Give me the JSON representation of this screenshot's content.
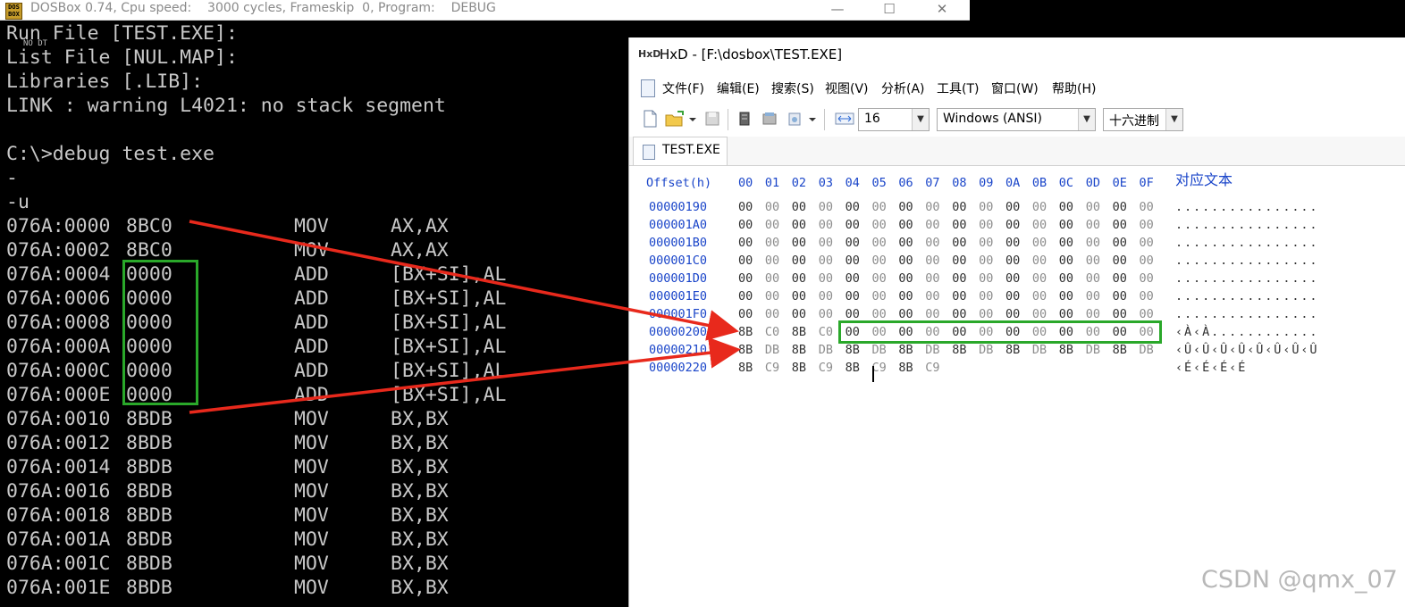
{
  "dosbox": {
    "title": "DOSBox 0.74, Cpu speed:    3000 cycles, Frameskip  0, Program:    DEBUG",
    "icon": "dosbox-icon",
    "window_buttons": [
      "—",
      "☐",
      "✕"
    ],
    "pre_lines": [
      "Run File [TEST.EXE]:",
      "List File [NUL.MAP]:",
      "Libraries [.LIB]:",
      "LINK : warning L4021: no stack segment",
      "",
      "C:\\>debug test.exe",
      "-",
      "-u"
    ],
    "overlay_text": "NO DT",
    "disasm": [
      {
        "addr": "076A:0000",
        "bytes": "8BC0",
        "mnemonic": "MOV",
        "operands": "AX,AX"
      },
      {
        "addr": "076A:0002",
        "bytes": "8BC0",
        "mnemonic": "MOV",
        "operands": "AX,AX"
      },
      {
        "addr": "076A:0004",
        "bytes": "0000",
        "mnemonic": "ADD",
        "operands": "[BX+SI],AL"
      },
      {
        "addr": "076A:0006",
        "bytes": "0000",
        "mnemonic": "ADD",
        "operands": "[BX+SI],AL"
      },
      {
        "addr": "076A:0008",
        "bytes": "0000",
        "mnemonic": "ADD",
        "operands": "[BX+SI],AL"
      },
      {
        "addr": "076A:000A",
        "bytes": "0000",
        "mnemonic": "ADD",
        "operands": "[BX+SI],AL"
      },
      {
        "addr": "076A:000C",
        "bytes": "0000",
        "mnemonic": "ADD",
        "operands": "[BX+SI],AL"
      },
      {
        "addr": "076A:000E",
        "bytes": "0000",
        "mnemonic": "ADD",
        "operands": "[BX+SI],AL"
      },
      {
        "addr": "076A:0010",
        "bytes": "8BDB",
        "mnemonic": "MOV",
        "operands": "BX,BX"
      },
      {
        "addr": "076A:0012",
        "bytes": "8BDB",
        "mnemonic": "MOV",
        "operands": "BX,BX"
      },
      {
        "addr": "076A:0014",
        "bytes": "8BDB",
        "mnemonic": "MOV",
        "operands": "BX,BX"
      },
      {
        "addr": "076A:0016",
        "bytes": "8BDB",
        "mnemonic": "MOV",
        "operands": "BX,BX"
      },
      {
        "addr": "076A:0018",
        "bytes": "8BDB",
        "mnemonic": "MOV",
        "operands": "BX,BX"
      },
      {
        "addr": "076A:001A",
        "bytes": "8BDB",
        "mnemonic": "MOV",
        "operands": "BX,BX"
      },
      {
        "addr": "076A:001C",
        "bytes": "8BDB",
        "mnemonic": "MOV",
        "operands": "BX,BX"
      },
      {
        "addr": "076A:001E",
        "bytes": "8BDB",
        "mnemonic": "MOV",
        "operands": "BX,BX"
      }
    ]
  },
  "hxd": {
    "title": "HxD - [F:\\dosbox\\TEST.EXE]",
    "menu": [
      "文件(F)",
      "编辑(E)",
      "搜索(S)",
      "视图(V)",
      "分析(A)",
      "工具(T)",
      "窗口(W)",
      "帮助(H)"
    ],
    "toolbar": {
      "bytes_per_row": "16",
      "charset": "Windows (ANSI)",
      "offset_base": "十六进制",
      "icons": [
        "new-file-icon",
        "open-folder-icon",
        "save-icon",
        "ram-icon",
        "disk-icon",
        "open-disk-icon",
        "bytes-per-row-icon"
      ]
    },
    "tab": "TEST.EXE",
    "header": {
      "offset_label": "Offset(h)",
      "columns": [
        "00",
        "01",
        "02",
        "03",
        "04",
        "05",
        "06",
        "07",
        "08",
        "09",
        "0A",
        "0B",
        "0C",
        "0D",
        "0E",
        "0F"
      ],
      "text_label": "对应文本"
    },
    "rows": [
      {
        "offset": "00000190",
        "bytes": [
          "00",
          "00",
          "00",
          "00",
          "00",
          "00",
          "00",
          "00",
          "00",
          "00",
          "00",
          "00",
          "00",
          "00",
          "00",
          "00"
        ],
        "text": "................"
      },
      {
        "offset": "000001A0",
        "bytes": [
          "00",
          "00",
          "00",
          "00",
          "00",
          "00",
          "00",
          "00",
          "00",
          "00",
          "00",
          "00",
          "00",
          "00",
          "00",
          "00"
        ],
        "text": "................"
      },
      {
        "offset": "000001B0",
        "bytes": [
          "00",
          "00",
          "00",
          "00",
          "00",
          "00",
          "00",
          "00",
          "00",
          "00",
          "00",
          "00",
          "00",
          "00",
          "00",
          "00"
        ],
        "text": "................"
      },
      {
        "offset": "000001C0",
        "bytes": [
          "00",
          "00",
          "00",
          "00",
          "00",
          "00",
          "00",
          "00",
          "00",
          "00",
          "00",
          "00",
          "00",
          "00",
          "00",
          "00"
        ],
        "text": "................"
      },
      {
        "offset": "000001D0",
        "bytes": [
          "00",
          "00",
          "00",
          "00",
          "00",
          "00",
          "00",
          "00",
          "00",
          "00",
          "00",
          "00",
          "00",
          "00",
          "00",
          "00"
        ],
        "text": "................"
      },
      {
        "offset": "000001E0",
        "bytes": [
          "00",
          "00",
          "00",
          "00",
          "00",
          "00",
          "00",
          "00",
          "00",
          "00",
          "00",
          "00",
          "00",
          "00",
          "00",
          "00"
        ],
        "text": "................"
      },
      {
        "offset": "000001F0",
        "bytes": [
          "00",
          "00",
          "00",
          "00",
          "00",
          "00",
          "00",
          "00",
          "00",
          "00",
          "00",
          "00",
          "00",
          "00",
          "00",
          "00"
        ],
        "text": "................"
      },
      {
        "offset": "00000200",
        "bytes": [
          "8B",
          "C0",
          "8B",
          "C0",
          "00",
          "00",
          "00",
          "00",
          "00",
          "00",
          "00",
          "00",
          "00",
          "00",
          "00",
          "00"
        ],
        "text": "‹À‹À............"
      },
      {
        "offset": "00000210",
        "bytes": [
          "8B",
          "DB",
          "8B",
          "DB",
          "8B",
          "DB",
          "8B",
          "DB",
          "8B",
          "DB",
          "8B",
          "DB",
          "8B",
          "DB",
          "8B",
          "DB"
        ],
        "text": "‹Û‹Û‹Û‹Û‹Û‹Û‹Û‹Û"
      },
      {
        "offset": "00000220",
        "bytes": [
          "8B",
          "C9",
          "8B",
          "C9",
          "8B",
          "C9",
          "8B",
          "C9"
        ],
        "text": "‹É‹É‹É‹É"
      }
    ]
  },
  "watermark": "CSDN @qmx_07",
  "colors": {
    "highlight_box": "#2aa82a",
    "arrow": "#e8291c",
    "offset_blue": "#1a45c9"
  }
}
